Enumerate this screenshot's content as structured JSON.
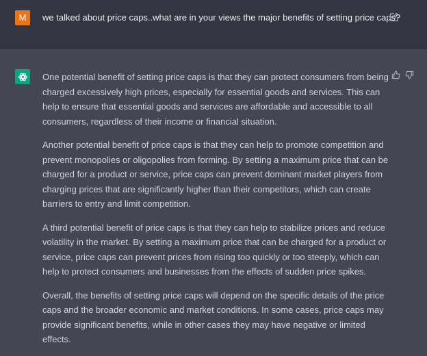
{
  "user_message": {
    "avatar_letter": "M",
    "text": "we talked about price caps..what are in your views the major benefits of setting price caps?",
    "icon": "edit-icon"
  },
  "assistant_message": {
    "avatar_icon": "openai-logo-icon",
    "feedback_icons": [
      "thumbs-up-icon",
      "thumbs-down-icon"
    ],
    "paragraphs": [
      "One potential benefit of setting price caps is that they can protect consumers from being charged excessively high prices, especially for essential goods and services. This can help to ensure that essential goods and services are affordable and accessible to all consumers, regardless of their income or financial situation.",
      "Another potential benefit of price caps is that they can help to promote competition and prevent monopolies or oligopolies from forming. By setting a maximum price that can be charged for a product or service, price caps can prevent dominant market players from charging prices that are significantly higher than their competitors, which can create barriers to entry and limit competition.",
      "A third potential benefit of price caps is that they can help to stabilize prices and reduce volatility in the market. By setting a maximum price that can be charged for a product or service, price caps can prevent prices from rising too quickly or too steeply, which can help to protect consumers and businesses from the effects of sudden price spikes.",
      "Overall, the benefits of setting price caps will depend on the specific details of the price caps and the broader economic and market conditions. In some cases, price caps may provide significant benefits, while in other cases they may have negative or limited effects."
    ]
  },
  "colors": {
    "user_bg": "#343541",
    "assistant_bg": "#444654",
    "user_avatar": "#e8751a",
    "assistant_avatar": "#10a37f",
    "text": "#d1d5db"
  }
}
